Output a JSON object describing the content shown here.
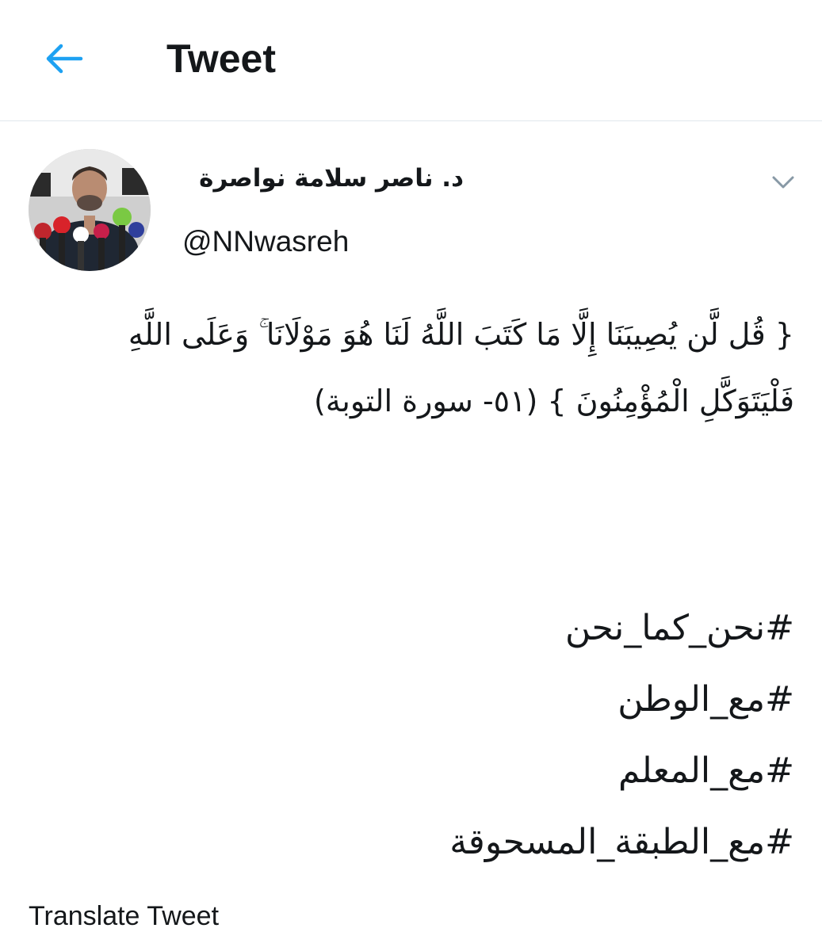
{
  "header": {
    "title": "Tweet",
    "back_icon": "arrow-left-icon",
    "accent_color": "#1da1f2"
  },
  "tweet": {
    "author": {
      "display_name": "د. ناصر سلامة نواصرة",
      "handle": "@NNwasreh"
    },
    "text": "{ قُل لَّن يُصِيبَنَا إِلَّا مَا كَتَبَ اللَّهُ لَنَا هُوَ مَوْلَانَا ۚ وَعَلَى اللَّهِ فَلْيَتَوَكَّلِ الْمُؤْمِنُونَ } (٥١- سورة التوبة)",
    "hashtags": [
      "#نحن_كما_نحن",
      "#مع_الوطن",
      "#مع_المعلم",
      "#مع_الطبقة_المسحوقة"
    ],
    "translate_label": "Translate Tweet",
    "menu_icon": "chevron-down-icon",
    "divider_color": "#e1e8ed"
  }
}
